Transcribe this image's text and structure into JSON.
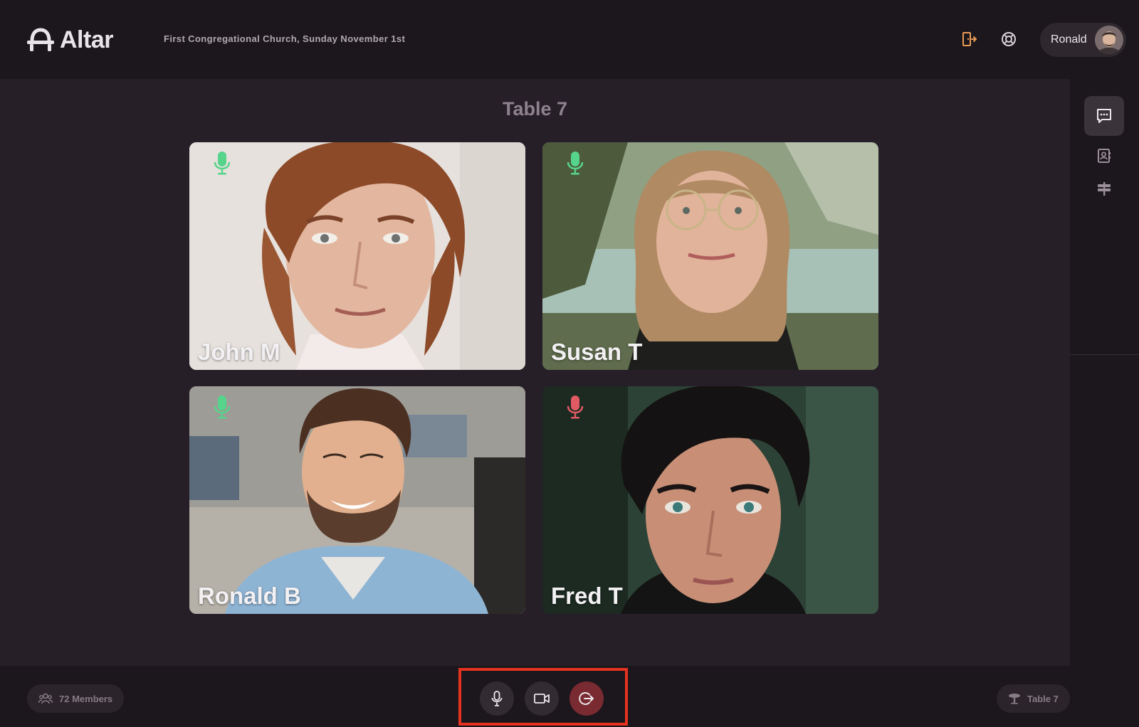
{
  "header": {
    "brand": "Altar",
    "event_title": "First Congregational Church, Sunday November 1st",
    "user_name": "Ronald"
  },
  "stage": {
    "room_title": "Table 7",
    "participants": [
      {
        "name": "John M",
        "mic_status": "on"
      },
      {
        "name": "Susan T",
        "mic_status": "on"
      },
      {
        "name": "Ronald B",
        "mic_status": "on"
      },
      {
        "name": "Fred T",
        "mic_status": "muted"
      }
    ]
  },
  "bottom": {
    "members_label": "72 Members",
    "table_label": "Table 7"
  },
  "colors": {
    "mic_on": "#56d48b",
    "mic_muted": "#e05a63",
    "accent_orange": "#e79a55",
    "highlight_frame": "#e6321f"
  },
  "icons": {
    "header": [
      "exit-door-icon",
      "lifebuoy-help-icon"
    ],
    "rail": [
      "chat-icon",
      "contact-card-icon",
      "signpost-icon"
    ],
    "controls": [
      "microphone-icon",
      "video-camera-icon",
      "leave-icon"
    ]
  }
}
